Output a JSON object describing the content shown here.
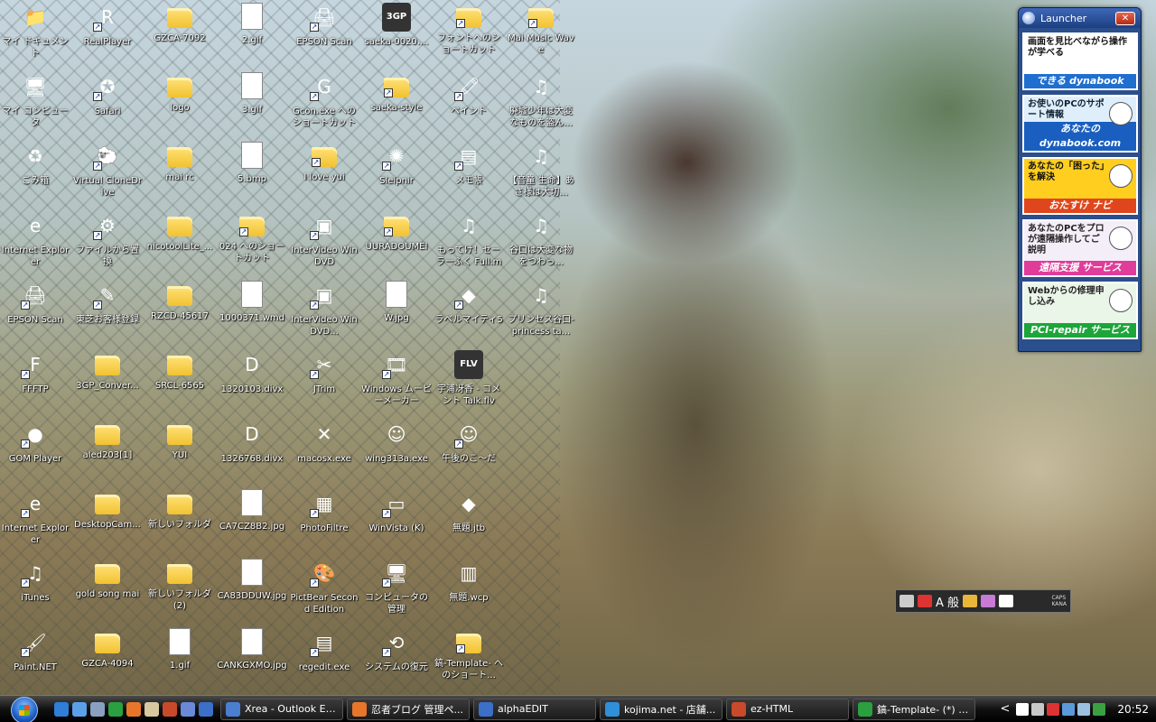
{
  "colors": {
    "folder": "#f2c230",
    "taskbar": "#111111",
    "launcher": "#2b4e8c",
    "close": "#c43a22"
  },
  "desktop": {
    "columns": [
      [
        {
          "label": "マイ ドキュメント",
          "icon": "my-documents-icon",
          "glyph": "📁",
          "shortcut": false
        },
        {
          "label": "マイ コンピュータ",
          "icon": "my-computer-icon",
          "glyph": "🖥",
          "shortcut": false
        },
        {
          "label": "ごみ箱",
          "icon": "recycle-bin-icon",
          "glyph": "♻",
          "shortcut": false
        },
        {
          "label": "Internet Explorer",
          "icon": "internet-explorer-icon",
          "glyph": "e",
          "shortcut": false
        },
        {
          "label": "EPSON Scan",
          "icon": "scanner-icon",
          "glyph": "🖨",
          "shortcut": true
        },
        {
          "label": "FFFTP",
          "icon": "ffftp-icon",
          "glyph": "F",
          "shortcut": true
        },
        {
          "label": "GOM Player",
          "icon": "gom-player-icon",
          "glyph": "●",
          "shortcut": true
        },
        {
          "label": "Internet Explorer",
          "icon": "internet-explorer-icon",
          "glyph": "e",
          "shortcut": true
        },
        {
          "label": "iTunes",
          "icon": "itunes-icon",
          "glyph": "♫",
          "shortcut": true
        },
        {
          "label": "Paint.NET",
          "icon": "paint-net-icon",
          "glyph": "🖌",
          "shortcut": true
        }
      ],
      [
        {
          "label": "RealPlayer",
          "icon": "realplayer-icon",
          "glyph": "R",
          "shortcut": true
        },
        {
          "label": "Safari",
          "icon": "safari-icon",
          "glyph": "✪",
          "shortcut": true
        },
        {
          "label": "Virtual CloneDrive",
          "icon": "clonedrive-icon",
          "glyph": "🐑",
          "shortcut": true
        },
        {
          "label": "ファイルから置換",
          "icon": "replace-icon",
          "glyph": "⚙",
          "shortcut": true
        },
        {
          "label": "東芝お客様登録",
          "icon": "registration-icon",
          "glyph": "✎",
          "shortcut": true
        },
        {
          "label": "3GP_Conver...",
          "icon": "folder-icon",
          "glyph": "",
          "folder": true
        },
        {
          "label": "aled203[1]",
          "icon": "folder-icon",
          "glyph": "",
          "folder": true
        },
        {
          "label": "DesktopCam...",
          "icon": "folder-icon",
          "glyph": "",
          "folder": true
        },
        {
          "label": "gold song mai",
          "icon": "folder-icon",
          "glyph": "",
          "folder": true
        },
        {
          "label": "GZCA-4094",
          "icon": "folder-icon",
          "glyph": "",
          "folder": true
        }
      ],
      [
        {
          "label": "GZCA-7092",
          "icon": "folder-icon",
          "glyph": "",
          "folder": true
        },
        {
          "label": "logo",
          "icon": "folder-icon",
          "glyph": "",
          "folder": true
        },
        {
          "label": "mai rc",
          "icon": "folder-icon",
          "glyph": "",
          "folder": true
        },
        {
          "label": "nicotoolLite_...",
          "icon": "folder-icon",
          "glyph": "",
          "folder": true
        },
        {
          "label": "RZCD-45617",
          "icon": "folder-icon",
          "glyph": "",
          "folder": true
        },
        {
          "label": "SRCL-6565",
          "icon": "folder-icon",
          "glyph": "",
          "folder": true
        },
        {
          "label": "YUI",
          "icon": "folder-icon",
          "glyph": "",
          "folder": true
        },
        {
          "label": "新しいフォルダ",
          "icon": "folder-icon",
          "glyph": "",
          "folder": true
        },
        {
          "label": "新しいフォルダ (2)",
          "icon": "folder-icon",
          "glyph": "",
          "folder": true
        },
        {
          "label": "1.gif",
          "icon": "gif-file-icon",
          "glyph": "",
          "file": true
        }
      ],
      [
        {
          "label": "2.gif",
          "icon": "gif-file-icon",
          "glyph": "",
          "file": true
        },
        {
          "label": "3.gif",
          "icon": "gif-file-icon",
          "glyph": "",
          "file": true
        },
        {
          "label": "5.bmp",
          "icon": "bmp-file-icon",
          "glyph": "",
          "file": true
        },
        {
          "label": "024 へのショートカット",
          "icon": "folder-icon",
          "glyph": "",
          "folder": true,
          "shortcut": true
        },
        {
          "label": "1000371.wmd",
          "icon": "wmd-file-icon",
          "glyph": "",
          "file": true
        },
        {
          "label": "1320103.divx",
          "icon": "divx-icon",
          "glyph": "D",
          "shortcut": false
        },
        {
          "label": "1326768.divx",
          "icon": "divx-icon",
          "glyph": "D",
          "shortcut": false
        },
        {
          "label": "CA7CZ8B2.jpg",
          "icon": "jpg-file-icon",
          "glyph": "",
          "file": true
        },
        {
          "label": "CA83DDUW.jpg",
          "icon": "jpg-file-icon",
          "glyph": "",
          "file": true
        },
        {
          "label": "CANKGXMO.jpg",
          "icon": "jpg-file-icon",
          "glyph": "",
          "file": true
        }
      ],
      [
        {
          "label": "EPSON Scan",
          "icon": "scanner-icon",
          "glyph": "🖨",
          "shortcut": true
        },
        {
          "label": "Gcon.exe へのショートカット",
          "icon": "gcon-icon",
          "glyph": "G",
          "shortcut": true
        },
        {
          "label": "I love yui",
          "icon": "folder-icon",
          "glyph": "",
          "folder": true,
          "shortcut": true
        },
        {
          "label": "InterVideo WinDVD",
          "icon": "windvd-icon",
          "glyph": "▣",
          "shortcut": true
        },
        {
          "label": "InterVideo WinDVD...",
          "icon": "windvd-icon",
          "glyph": "▣",
          "shortcut": true
        },
        {
          "label": "JTrim",
          "icon": "jtrim-icon",
          "glyph": "✂",
          "shortcut": true
        },
        {
          "label": "macosx.exe",
          "icon": "macosx-icon",
          "glyph": "✕",
          "shortcut": false
        },
        {
          "label": "PhotoFiltre",
          "icon": "photofiltre-icon",
          "glyph": "▦",
          "shortcut": true
        },
        {
          "label": "PictBear Second Edition",
          "icon": "pictbear-icon",
          "glyph": "🎨",
          "shortcut": true
        },
        {
          "label": "regedit.exe",
          "icon": "regedit-icon",
          "glyph": "▤",
          "shortcut": true
        }
      ],
      [
        {
          "label": "saeka-0020....",
          "icon": "3gp-icon",
          "glyph": "3GP",
          "shortcut": false
        },
        {
          "label": "saeka-style",
          "icon": "folder-icon",
          "glyph": "",
          "folder": true,
          "shortcut": true
        },
        {
          "label": "Sleipnir",
          "icon": "sleipnir-icon",
          "glyph": "✺",
          "shortcut": true
        },
        {
          "label": "UURADOUMEI",
          "icon": "folder-icon",
          "glyph": "",
          "folder": true,
          "shortcut": true
        },
        {
          "label": "W.jpg",
          "icon": "jpg-file-icon",
          "glyph": "",
          "file": true
        },
        {
          "label": "Windows ムービーメーカー",
          "icon": "movie-maker-icon",
          "glyph": "🎞",
          "shortcut": true
        },
        {
          "label": "wing313a.exe",
          "icon": "wing-icon",
          "glyph": "☺",
          "shortcut": false
        },
        {
          "label": "WinVista (K)",
          "icon": "drive-icon",
          "glyph": "▭",
          "shortcut": true
        },
        {
          "label": "コンピュータの管理",
          "icon": "computer-management-icon",
          "glyph": "🖥",
          "shortcut": true
        },
        {
          "label": "システムの復元",
          "icon": "system-restore-icon",
          "glyph": "⟲",
          "shortcut": true
        }
      ],
      [
        {
          "label": "フォントへのショートカット",
          "icon": "fonts-folder-icon",
          "glyph": "",
          "folder": true,
          "shortcut": true
        },
        {
          "label": "ペイント",
          "icon": "paint-icon",
          "glyph": "🖍",
          "shortcut": true
        },
        {
          "label": "メモ帳",
          "icon": "notepad-icon",
          "glyph": "▤",
          "shortcut": true
        },
        {
          "label": "もってけ！セーラーふく Full.mp3",
          "icon": "music-file-icon",
          "glyph": "♫",
          "shortcut": false
        },
        {
          "label": "ラベルマイティ5",
          "icon": "label-mighty-icon",
          "glyph": "◆",
          "shortcut": true
        },
        {
          "label": "宇浦冴香 - コメント Talk.flv",
          "icon": "flv-file-icon",
          "glyph": "FLV",
          "shortcut": false
        },
        {
          "label": "午後のこ～だ",
          "icon": "gogo-icon",
          "glyph": "☺",
          "shortcut": true
        },
        {
          "label": "無題.jtb",
          "icon": "jtb-file-icon",
          "glyph": "◆",
          "shortcut": false
        },
        {
          "label": "無題.wcp",
          "icon": "wcp-file-icon",
          "glyph": "▥",
          "shortcut": false
        },
        {
          "label": "鎬-Template- へのショート...",
          "icon": "folder-icon",
          "glyph": "",
          "folder": true,
          "shortcut": true
        }
      ],
      [
        {
          "label": "Mai Music Wave",
          "icon": "folder-icon",
          "glyph": "",
          "folder": true,
          "shortcut": true
        },
        {
          "label": "廃墟少年は大変なものを盗ん...",
          "icon": "music-file-icon",
          "glyph": "♫",
          "shortcut": false
        },
        {
          "label": "【音童 生命】あさ様は大切...",
          "icon": "music-file-icon",
          "glyph": "♫",
          "shortcut": false
        },
        {
          "label": "谷口は大変な物をつわっ...",
          "icon": "music-file-icon",
          "glyph": "♫",
          "shortcut": false
        },
        {
          "label": "プリンセス谷口-princess ta...",
          "icon": "music-file-icon",
          "glyph": "♫",
          "shortcut": false
        }
      ]
    ]
  },
  "launcher": {
    "title": "Launcher",
    "close": "✕",
    "banners": [
      {
        "text": "画面を見比べながら操作が学べる",
        "bottom": "できる dynabook"
      },
      {
        "text": "お使いのPCのサポート情報",
        "bottom": "あなたの dynabook.com"
      },
      {
        "text": "あなたの「困った」を解決",
        "bottom": "おたすけ ナビ"
      },
      {
        "text": "あなたのPCをプロが遠隔操作してご説明",
        "bottom": "遠隔支援 サービス"
      },
      {
        "text": "Webからの修理申し込み",
        "bottom": "PCI-repair サービス"
      }
    ]
  },
  "langbar": {
    "mode": "A 般",
    "caps": "CAPS",
    "kana": "KANA"
  },
  "taskbar": {
    "tasks": [
      {
        "label": "Xrea - Outlook Ex...",
        "color": "#4a7fd0"
      },
      {
        "label": "忍者ブログ 管理ペ...",
        "color": "#e8762a"
      },
      {
        "label": "alphaEDIT",
        "color": "#3b6fc8"
      },
      {
        "label": "kojima.net - 店舗...",
        "color": "#2f8fd8"
      },
      {
        "label": "ez-HTML",
        "color": "#c84a2a"
      },
      {
        "label": "鎬-Template- (*) -...",
        "color": "#2aa040"
      }
    ],
    "chevron": "<",
    "clock": "20:52"
  }
}
